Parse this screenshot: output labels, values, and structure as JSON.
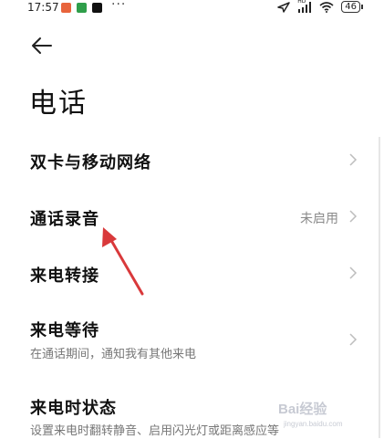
{
  "status_bar": {
    "time": "17:57",
    "network_label": "HD",
    "battery": "46"
  },
  "header": {
    "back_icon": "arrow-left-icon",
    "title": "电话"
  },
  "settings": {
    "items": [
      {
        "label": "双卡与移动网络",
        "value": "",
        "subtitle": ""
      },
      {
        "label": "通话录音",
        "value": "未启用",
        "subtitle": ""
      },
      {
        "label": "来电转接",
        "value": "",
        "subtitle": ""
      },
      {
        "label": "来电等待",
        "value": "",
        "subtitle": "在通话期间，通知我有其他来电"
      },
      {
        "label": "来电时状态",
        "value": "",
        "subtitle": "设置来电时翻转静音、启用闪光灯或距离感应等"
      }
    ]
  },
  "watermark": {
    "text": "Bai经验",
    "url": "jingyan.baidu.com"
  },
  "colors": {
    "annotation_arrow": "#d9393b",
    "app_icon_1": "#e8643c",
    "app_icon_2": "#2f9e4a",
    "app_icon_3": "#111111"
  }
}
